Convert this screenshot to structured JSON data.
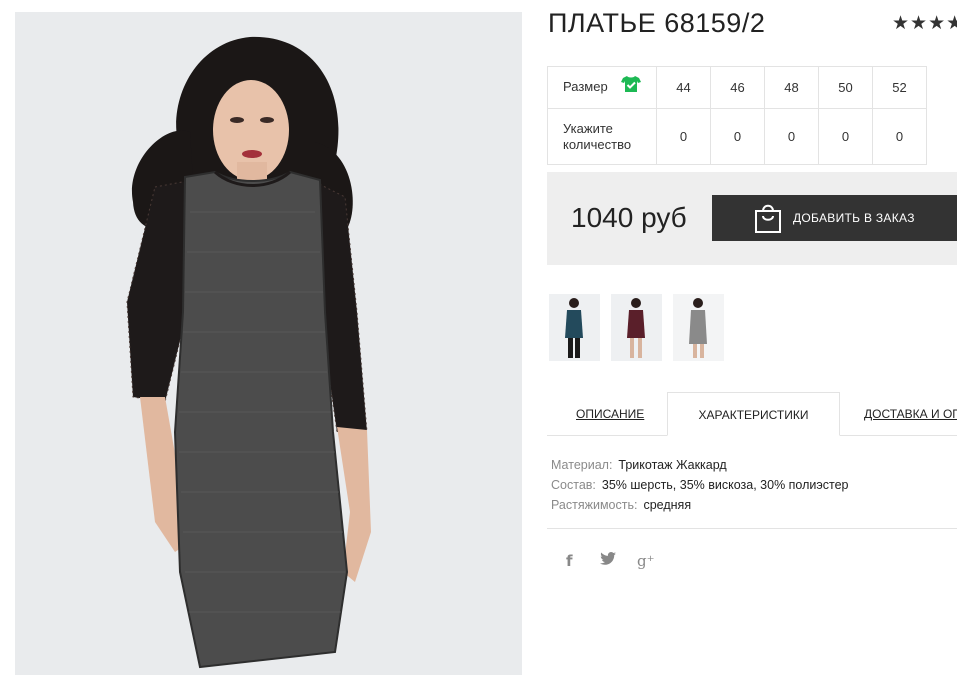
{
  "product": {
    "title": "ПЛАТЬЕ 68159/2",
    "rating_stars": "★★★★★",
    "main_image_icon": "dress-photo",
    "thumbnails": [
      {
        "icon": "dress-thumb-teal",
        "color": "#234a5c"
      },
      {
        "icon": "dress-thumb-burgundy",
        "color": "#5a1f2a"
      },
      {
        "icon": "dress-thumb-grey",
        "color": "#8a8a8a"
      }
    ]
  },
  "size_table": {
    "size_label": "Размер",
    "size_icon": "tshirt-check-icon",
    "sizes": [
      "44",
      "46",
      "48",
      "50",
      "52"
    ],
    "qty_label_line1": "Укажите",
    "qty_label_line2": "количество",
    "quantities": [
      "0",
      "0",
      "0",
      "0",
      "0"
    ]
  },
  "price": {
    "value": "1040 руб",
    "button_label": "Добавить в заказ",
    "button_icon": "shopping-bag-icon"
  },
  "tabs": [
    {
      "label": "Описание",
      "active": false
    },
    {
      "label": "Характеристики",
      "active": true
    },
    {
      "label": "Доставка и оплата",
      "active": false
    }
  ],
  "characteristics": [
    {
      "key": "Материал:",
      "value": "Трикотаж Жаккард"
    },
    {
      "key": "Состав:",
      "value": "35% шерсть, 35% вискоза, 30% полиэстер"
    },
    {
      "key": "Растяжимость:",
      "value": "средняя"
    }
  ],
  "social": {
    "facebook": "f",
    "twitter": "🐦",
    "google_plus": "g⁺"
  },
  "colors": {
    "accent_dark": "#333333",
    "price_bg": "#eeeeee",
    "check_green": "#1db954"
  }
}
